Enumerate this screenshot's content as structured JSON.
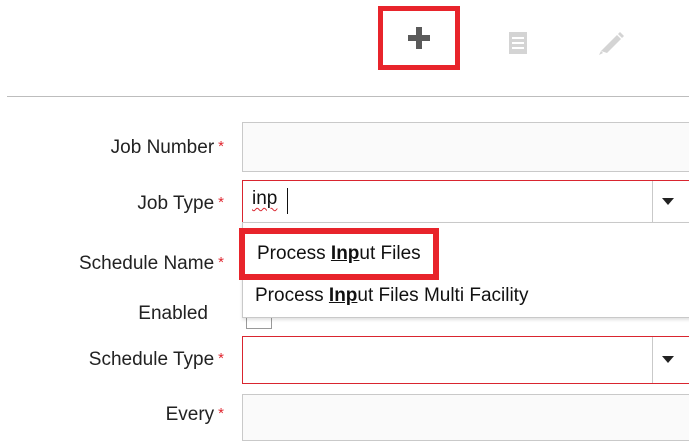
{
  "toolbar": {
    "add_icon": "plus-icon",
    "list_icon": "list-icon",
    "edit_icon": "pencil-icon"
  },
  "form": {
    "job_number_label": "Job Number",
    "job_type_label": "Job Type",
    "schedule_name_label": "Schedule Name",
    "enabled_label": "Enabled",
    "schedule_type_label": "Schedule Type",
    "every_label": "Every",
    "required_marker": "*",
    "job_type_value": "inp"
  },
  "dropdown": {
    "options": [
      {
        "before": "Process ",
        "match": "Inp",
        "after": "ut Files"
      },
      {
        "before": "Process ",
        "match": "Inp",
        "after": "ut Files Multi Facility"
      }
    ]
  },
  "colors": {
    "highlight": "#e8242b",
    "required": "#e0262f",
    "invalid_border": "#d9252f"
  }
}
